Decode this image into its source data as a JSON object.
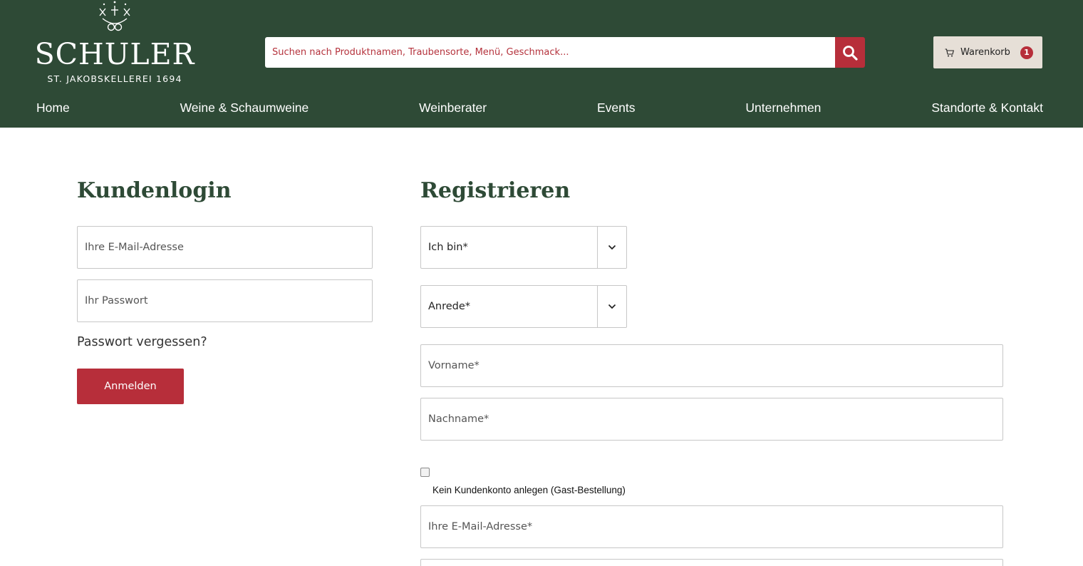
{
  "header": {
    "logo": {
      "wordmark": "SCHULER",
      "subline": "ST. JAKOBSKELLEREI 1694"
    },
    "search": {
      "placeholder": "Suchen nach Produktnamen, Traubensorte, Menü, Geschmack..."
    },
    "cart": {
      "label": "Warenkorb",
      "count": "1"
    }
  },
  "nav": {
    "items": [
      "Home",
      "Weine & Schaumweine",
      "Weinberater",
      "Events",
      "Unternehmen",
      "Standorte & Kontakt"
    ]
  },
  "login": {
    "title": "Kundenlogin",
    "email_placeholder": "Ihre E-Mail-Adresse",
    "password_placeholder": "Ihr Passwort",
    "forgot_link": "Passwort vergessen?",
    "submit_label": "Anmelden"
  },
  "register": {
    "title": "Registrieren",
    "type_select": "Ich bin*",
    "salutation_select": "Anrede*",
    "firstname_placeholder": "Vorname*",
    "lastname_placeholder": "Nachname*",
    "guest_checkbox_label": "Kein Kundenkonto anlegen (Gast-Bestellung)",
    "guest_checked": false,
    "email_placeholder": "Ihre E-Mail-Adresse*"
  },
  "colors": {
    "header_bg": "#2e4a36",
    "accent_red": "#b72e3a",
    "cart_bg": "#e6dfd7",
    "heading_green": "#2e4a36"
  },
  "icons": {
    "search": "search-icon",
    "cart": "cart-icon",
    "chevron": "chevron-down-icon",
    "logo": "emblem-icon"
  }
}
